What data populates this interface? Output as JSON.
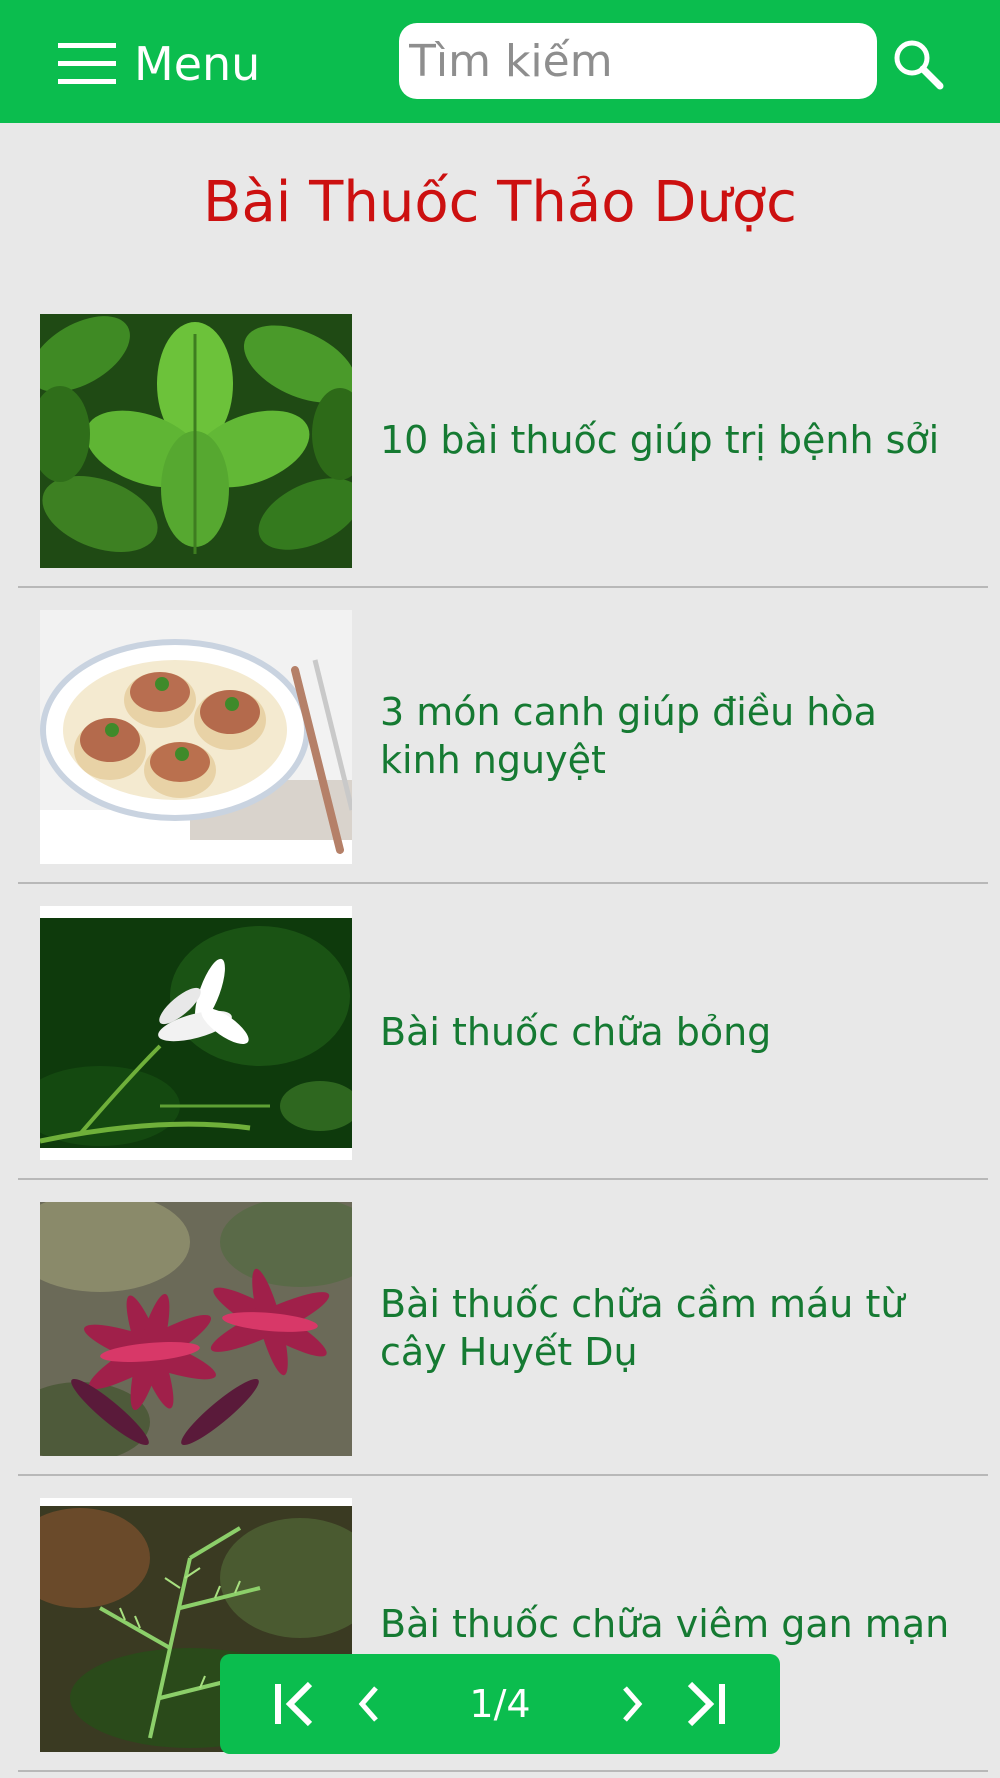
{
  "header": {
    "menu_label": "Menu",
    "search_placeholder": "Tìm kiếm",
    "search_value": "",
    "background_color": "#0bbd4e"
  },
  "page": {
    "title": "Bài Thuốc Thảo Dược",
    "title_color": "#cc1010"
  },
  "articles": [
    {
      "title": "10 bài thuốc giúp trị bệnh sởi",
      "image": "mint-leaves-photo"
    },
    {
      "title": "3 món canh giúp điều hòa kinh nguyệt",
      "image": "stuffed-dish-bowl-photo"
    },
    {
      "title": "Bài thuốc chữa bỏng",
      "image": "white-flower-photo"
    },
    {
      "title": "Bài thuốc chữa cầm máu từ cây Huyết Dụ",
      "image": "red-cordyline-plant-photo"
    },
    {
      "title": "Bài thuốc chữa viêm gan mạn",
      "image": "green-herb-photo"
    }
  ],
  "pager": {
    "current": "1/4",
    "icons": [
      "first-page-icon",
      "prev-page-icon",
      "next-page-icon",
      "last-page-icon"
    ]
  },
  "colors": {
    "accent": "#0bbd4e",
    "article_text": "#157a32",
    "background": "#e8e8e8"
  }
}
